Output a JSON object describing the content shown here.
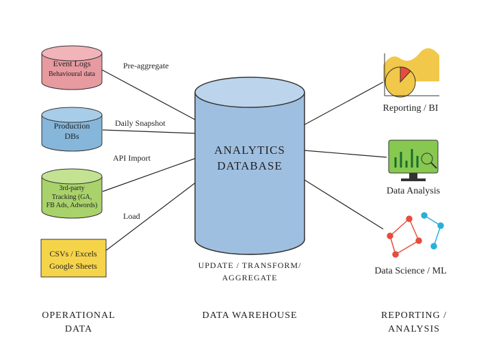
{
  "sources": {
    "eventlogs": {
      "title": "Event Logs",
      "subtitle": "Behavioural data",
      "arrow_label": "Pre-aggregate"
    },
    "proddbs": {
      "title": "Production",
      "subtitle": "DBs",
      "arrow_label": "Daily Snapshot"
    },
    "tracking": {
      "title": "3rd-party",
      "subtitle": "Tracking (GA,",
      "subtitle2": "FB Ads, Adwords)",
      "arrow_label": "API Import"
    },
    "csvs": {
      "title": "CSVs / Excels",
      "subtitle": "Google Sheets",
      "arrow_label": "Load"
    }
  },
  "warehouse": {
    "title1": "ANALYTICS",
    "title2": "DATABASE",
    "caption1": "UPDATE / TRANSFORM/",
    "caption2": "AGGREGATE"
  },
  "outputs": {
    "reporting": {
      "label": "Reporting / BI"
    },
    "analysis": {
      "label": "Data Analysis"
    },
    "ml": {
      "label": "Data Science / ML"
    }
  },
  "sections": {
    "left1": "OPERATIONAL",
    "left2": "DATA",
    "mid": "DATA WAREHOUSE",
    "right1": "REPORTING /",
    "right2": "ANALYSIS"
  },
  "colors": {
    "pink": "#e79aa0",
    "blue": "#86b6d9",
    "green": "#a9d26b",
    "yellow": "#f6d44a",
    "cylinder": "#9fbfe1",
    "monitor": "#87c850",
    "red": "#e74c3c",
    "cyan": "#2ab0d8",
    "area": "#f2c84b"
  }
}
